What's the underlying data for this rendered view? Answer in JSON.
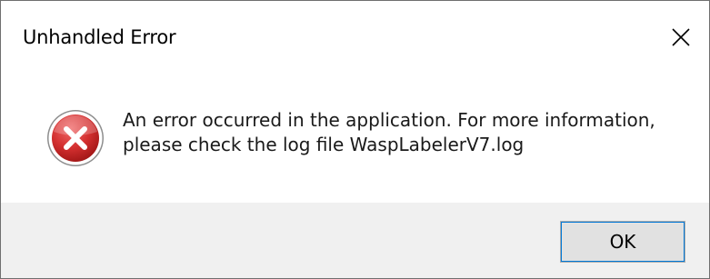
{
  "dialog": {
    "title": "Unhandled Error",
    "message_line1": "An error occurred in the application. For more information,",
    "message_line2": "please check the log file WaspLabelerV7.log",
    "ok_label": "OK",
    "icon": "error-icon",
    "close_icon": "close-icon"
  },
  "colors": {
    "error_red": "#d32f2f",
    "footer_bg": "#f0f0f0",
    "button_bg": "#e1e1e1",
    "focus_outline": "#0078d7"
  }
}
